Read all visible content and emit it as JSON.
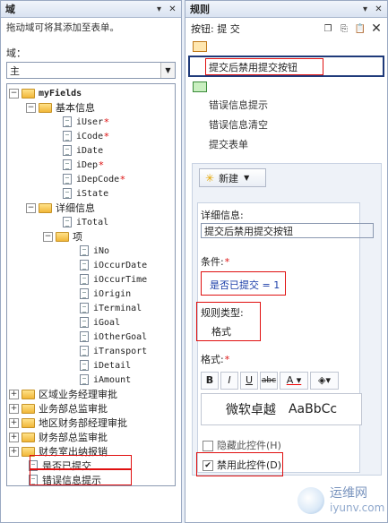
{
  "left_panel": {
    "title": "域",
    "hint": "拖动域可将其添加至表单。",
    "field_label": "域：",
    "combo_value": "主",
    "tree": [
      {
        "label": "myFields",
        "type": "folder",
        "depth": 0,
        "exp": "minus",
        "bold": true
      },
      {
        "label": "基本信息",
        "type": "folder",
        "depth": 1,
        "exp": "minus"
      },
      {
        "label": "iUser",
        "type": "doc",
        "depth": 2,
        "req": true
      },
      {
        "label": "iCode",
        "type": "doc",
        "depth": 2,
        "req": true
      },
      {
        "label": "iDate",
        "type": "doc",
        "depth": 2
      },
      {
        "label": "iDep",
        "type": "doc",
        "depth": 2,
        "req": true
      },
      {
        "label": "iDepCode",
        "type": "doc",
        "depth": 2,
        "req": true
      },
      {
        "label": "iState",
        "type": "doc",
        "depth": 2
      },
      {
        "label": "详细信息",
        "type": "folder",
        "depth": 1,
        "exp": "minus"
      },
      {
        "label": "iTotal",
        "type": "doc",
        "depth": 2
      },
      {
        "label": "项",
        "type": "folder",
        "depth": 2,
        "exp": "minus"
      },
      {
        "label": "iNo",
        "type": "doc",
        "depth": 3
      },
      {
        "label": "iOccurDate",
        "type": "doc",
        "depth": 3
      },
      {
        "label": "iOccurTime",
        "type": "doc",
        "depth": 3
      },
      {
        "label": "iOrigin",
        "type": "doc",
        "depth": 3
      },
      {
        "label": "iTerminal",
        "type": "doc",
        "depth": 3
      },
      {
        "label": "iGoal",
        "type": "doc",
        "depth": 3
      },
      {
        "label": "iOtherGoal",
        "type": "doc",
        "depth": 3
      },
      {
        "label": "iTransport",
        "type": "doc",
        "depth": 3
      },
      {
        "label": "iDetail",
        "type": "doc",
        "depth": 3
      },
      {
        "label": "iAmount",
        "type": "doc",
        "depth": 3
      },
      {
        "label": "区域业务经理审批",
        "type": "folder",
        "depth": 0,
        "exp": "plus"
      },
      {
        "label": "业务部总监审批",
        "type": "folder",
        "depth": 0,
        "exp": "plus"
      },
      {
        "label": "地区财务部经理审批",
        "type": "folder",
        "depth": 0,
        "exp": "plus"
      },
      {
        "label": "财务部总监审批",
        "type": "folder",
        "depth": 0,
        "exp": "plus"
      },
      {
        "label": "财务室出纳报销",
        "type": "folder",
        "depth": 0,
        "exp": "plus"
      },
      {
        "label": "是否已提交",
        "type": "doc",
        "depth": 0
      },
      {
        "label": "错误信息提示",
        "type": "doc",
        "depth": 0
      }
    ]
  },
  "right_panel": {
    "title": "规则",
    "subtitle": "按钮: 提 交",
    "selected_rule": "提交后禁用提交按钮",
    "actions": [
      "错误信息提示",
      "错误信息清空",
      "提交表单"
    ],
    "new_button": "新建",
    "detail_label": "详细信息:",
    "detail_value": "提交后禁用提交按钮",
    "condition_label": "条件:",
    "condition_value": "是否已提交 = 1",
    "rule_type_label": "规则类型:",
    "rule_type_value": "格式",
    "format_label": "格式:",
    "preview_cn": "微软卓越",
    "preview_en": "AaBbCc",
    "hide_label": "隐藏此控件(H)",
    "disable_label": "禁用此控件(D)"
  },
  "watermark": {
    "cn": "运维网",
    "url": "iyunv.com"
  }
}
